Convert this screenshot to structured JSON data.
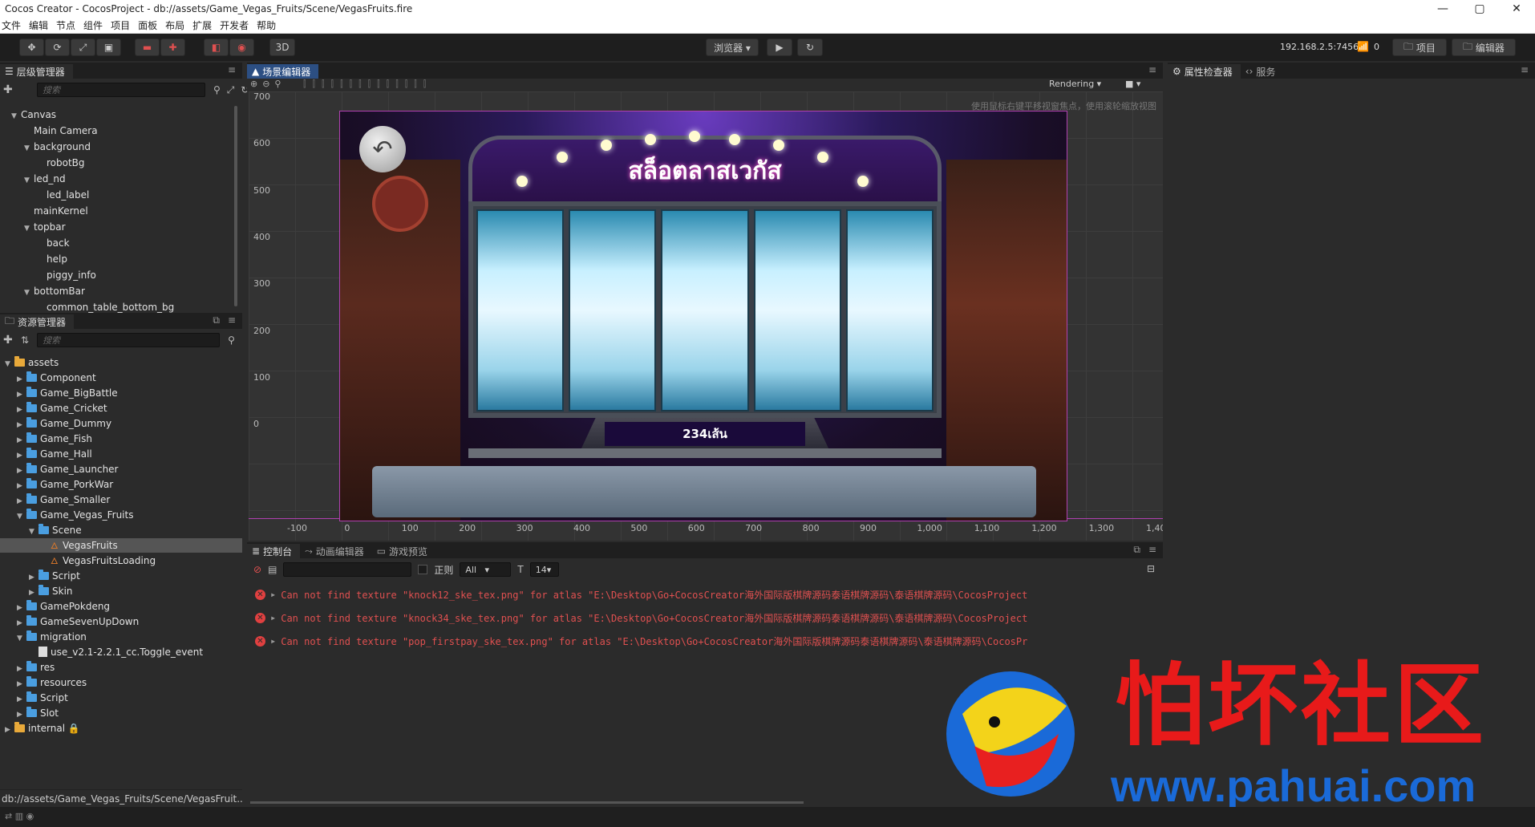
{
  "window": {
    "title": "Cocos Creator - CocosProject - db://assets/Game_Vegas_Fruits/Scene/VegasFruits.fire",
    "controls": [
      "—",
      "▢",
      "✕"
    ]
  },
  "menu": [
    "文件",
    "编辑",
    "节点",
    "组件",
    "项目",
    "面板",
    "布局",
    "扩展",
    "开发者",
    "帮助"
  ],
  "toolbar": {
    "mode_3d": "3D",
    "browser_label": "浏览器 ▾",
    "ip": "192.168.2.5:7456",
    "wifi_count": "0",
    "project_btn": "项目",
    "editor_btn": "编辑器"
  },
  "hierarchy": {
    "tab": "层级管理器",
    "search_placeholder": "搜索",
    "nodes": [
      {
        "label": "Canvas",
        "depth": 0,
        "arrow": "▼"
      },
      {
        "label": "Main Camera",
        "depth": 1,
        "arrow": ""
      },
      {
        "label": "background",
        "depth": 1,
        "arrow": "▼"
      },
      {
        "label": "robotBg",
        "depth": 2,
        "arrow": ""
      },
      {
        "label": "led_nd",
        "depth": 1,
        "arrow": "▼"
      },
      {
        "label": "led_label",
        "depth": 2,
        "arrow": ""
      },
      {
        "label": "mainKernel",
        "depth": 1,
        "arrow": ""
      },
      {
        "label": "topbar",
        "depth": 1,
        "arrow": "▼"
      },
      {
        "label": "back",
        "depth": 2,
        "arrow": ""
      },
      {
        "label": "help",
        "depth": 2,
        "arrow": ""
      },
      {
        "label": "piggy_info",
        "depth": 2,
        "arrow": ""
      },
      {
        "label": "bottomBar",
        "depth": 1,
        "arrow": "▼"
      },
      {
        "label": "common_table_bottom_bg",
        "depth": 2,
        "arrow": ""
      }
    ]
  },
  "assets": {
    "tab": "资源管理器",
    "search_placeholder": "搜索",
    "items": [
      {
        "label": "assets",
        "depth": 0,
        "arrow": "▼",
        "kind": "root"
      },
      {
        "label": "Component",
        "depth": 1,
        "arrow": "▶",
        "kind": "folder"
      },
      {
        "label": "Game_BigBattle",
        "depth": 1,
        "arrow": "▶",
        "kind": "folder"
      },
      {
        "label": "Game_Cricket",
        "depth": 1,
        "arrow": "▶",
        "kind": "folder"
      },
      {
        "label": "Game_Dummy",
        "depth": 1,
        "arrow": "▶",
        "kind": "folder"
      },
      {
        "label": "Game_Fish",
        "depth": 1,
        "arrow": "▶",
        "kind": "folder"
      },
      {
        "label": "Game_Hall",
        "depth": 1,
        "arrow": "▶",
        "kind": "folder"
      },
      {
        "label": "Game_Launcher",
        "depth": 1,
        "arrow": "▶",
        "kind": "folder"
      },
      {
        "label": "Game_PorkWar",
        "depth": 1,
        "arrow": "▶",
        "kind": "folder"
      },
      {
        "label": "Game_Smaller",
        "depth": 1,
        "arrow": "▶",
        "kind": "folder"
      },
      {
        "label": "Game_Vegas_Fruits",
        "depth": 1,
        "arrow": "▼",
        "kind": "folder"
      },
      {
        "label": "Scene",
        "depth": 2,
        "arrow": "▼",
        "kind": "folder"
      },
      {
        "label": "VegasFruits",
        "depth": 3,
        "arrow": "",
        "kind": "fire",
        "selected": true
      },
      {
        "label": "VegasFruitsLoading",
        "depth": 3,
        "arrow": "",
        "kind": "fire"
      },
      {
        "label": "Script",
        "depth": 2,
        "arrow": "▶",
        "kind": "folder"
      },
      {
        "label": "Skin",
        "depth": 2,
        "arrow": "▶",
        "kind": "folder"
      },
      {
        "label": "GamePokdeng",
        "depth": 1,
        "arrow": "▶",
        "kind": "folder"
      },
      {
        "label": "GameSevenUpDown",
        "depth": 1,
        "arrow": "▶",
        "kind": "folder"
      },
      {
        "label": "migration",
        "depth": 1,
        "arrow": "▼",
        "kind": "folder"
      },
      {
        "label": "use_v2.1-2.2.1_cc.Toggle_event",
        "depth": 2,
        "arrow": "",
        "kind": "file"
      },
      {
        "label": "res",
        "depth": 1,
        "arrow": "▶",
        "kind": "folder"
      },
      {
        "label": "resources",
        "depth": 1,
        "arrow": "▶",
        "kind": "folder"
      },
      {
        "label": "Script",
        "depth": 1,
        "arrow": "▶",
        "kind": "folder"
      },
      {
        "label": "Slot",
        "depth": 1,
        "arrow": "▶",
        "kind": "folder"
      },
      {
        "label": "internal 🔒",
        "depth": 0,
        "arrow": "▶",
        "kind": "root"
      }
    ],
    "status_path": "db://assets/Game_Vegas_Fruits/Scene/VegasFruit..."
  },
  "scene": {
    "tab": "场景编辑器",
    "rendering": "Rendering",
    "hint": "使用鼠标右键平移视窗焦点，使用滚轮缩放视图",
    "y_ticks": [
      "700",
      "600",
      "500",
      "400",
      "300",
      "200",
      "100",
      "0"
    ],
    "x_ticks": [
      "-100",
      "0",
      "100",
      "200",
      "300",
      "400",
      "500",
      "600",
      "700",
      "800",
      "900",
      "1,000",
      "1,100",
      "1,200",
      "1,300",
      "1,40"
    ],
    "game_title": "สล็อตลาสเวกัส",
    "game_counter": "234เส้น"
  },
  "inspector": {
    "tab_properties": "属性检查器",
    "tab_services": "服务"
  },
  "console": {
    "tab_console": "控制台",
    "tab_animation": "动画编辑器",
    "tab_preview": "游戏预览",
    "regex_label": "正则",
    "filter_value": "All",
    "font_size": "14",
    "errors": [
      "Can not find texture \"knock12_ske_tex.png\" for atlas \"E:\\Desktop\\Go+CocosCreator海外国际版棋牌源码泰语棋牌源码\\泰语棋牌源码\\CocosProject",
      "Can not find texture \"knock34_ske_tex.png\" for atlas \"E:\\Desktop\\Go+CocosCreator海外国际版棋牌源码泰语棋牌源码\\泰语棋牌源码\\CocosProject",
      "Can not find texture \"pop_firstpay_ske_tex.png\" for atlas \"E:\\Desktop\\Go+CocosCreator海外国际版棋牌源码泰语棋牌源码\\泰语棋牌源码\\CocosPr"
    ]
  },
  "watermark": {
    "brand": "怕坏社区",
    "url": "www.pahuai.com"
  }
}
